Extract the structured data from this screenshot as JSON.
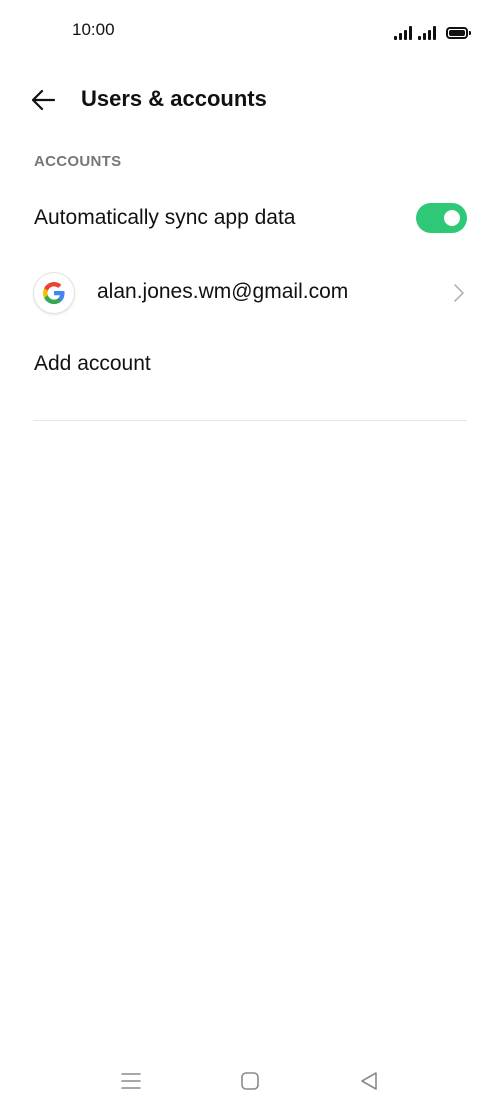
{
  "status_bar": {
    "time": "10:00",
    "icons": [
      "signal-icon",
      "signal-icon",
      "battery-icon"
    ]
  },
  "header": {
    "back_icon": "arrow-left-icon",
    "title": "Users & accounts"
  },
  "accounts_section": {
    "header": "ACCOUNTS",
    "sync": {
      "label": "Automatically sync app data",
      "enabled": true,
      "toggle_color": "#2ec877"
    },
    "account": {
      "icon": "google-icon",
      "email": "alan.jones.wm@gmail.com",
      "chevron_icon": "chevron-right-icon"
    },
    "add_account_label": "Add account"
  },
  "nav_bar": {
    "buttons": [
      "menu-icon",
      "home-icon",
      "back-icon"
    ]
  }
}
